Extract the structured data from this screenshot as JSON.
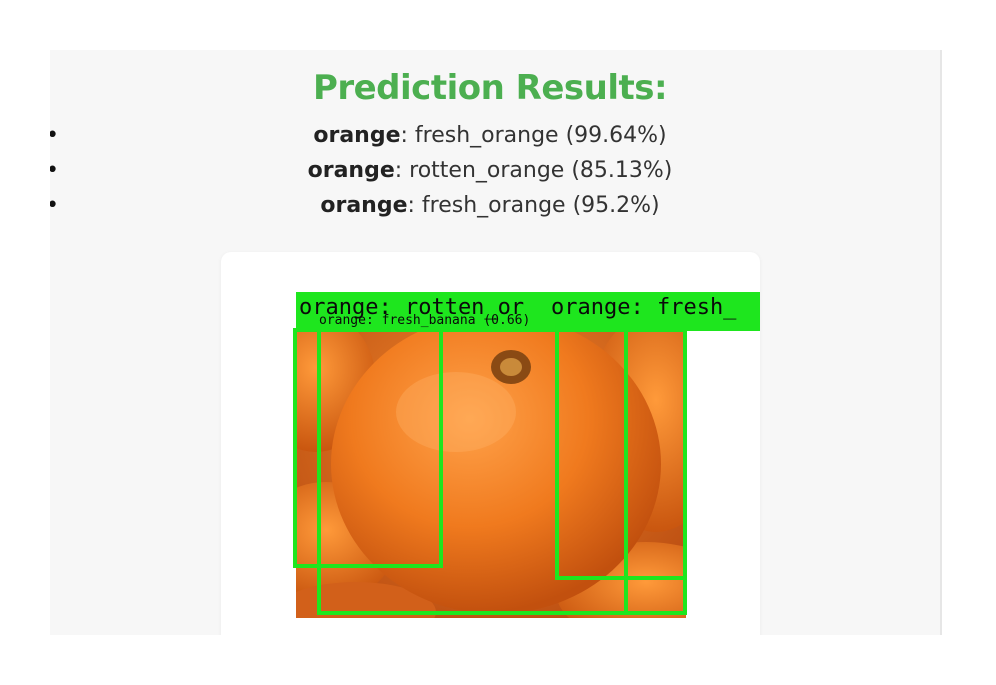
{
  "page": {
    "title": "Prediction Results:"
  },
  "results": [
    {
      "class": "orange",
      "prediction": ": fresh_orange (99.64%)"
    },
    {
      "class": "orange",
      "prediction": ": rotten_orange (85.13%)"
    },
    {
      "class": "orange",
      "prediction": ": fresh_orange (95.2%)"
    }
  ],
  "image": {
    "labels": {
      "label_1": "orange: rotten_or",
      "label_2": "orange: fresh_",
      "label_3": "orange: fresh_banana (0.66)"
    }
  },
  "colors": {
    "accent": "#4caf50",
    "box": "#1ee61e"
  }
}
